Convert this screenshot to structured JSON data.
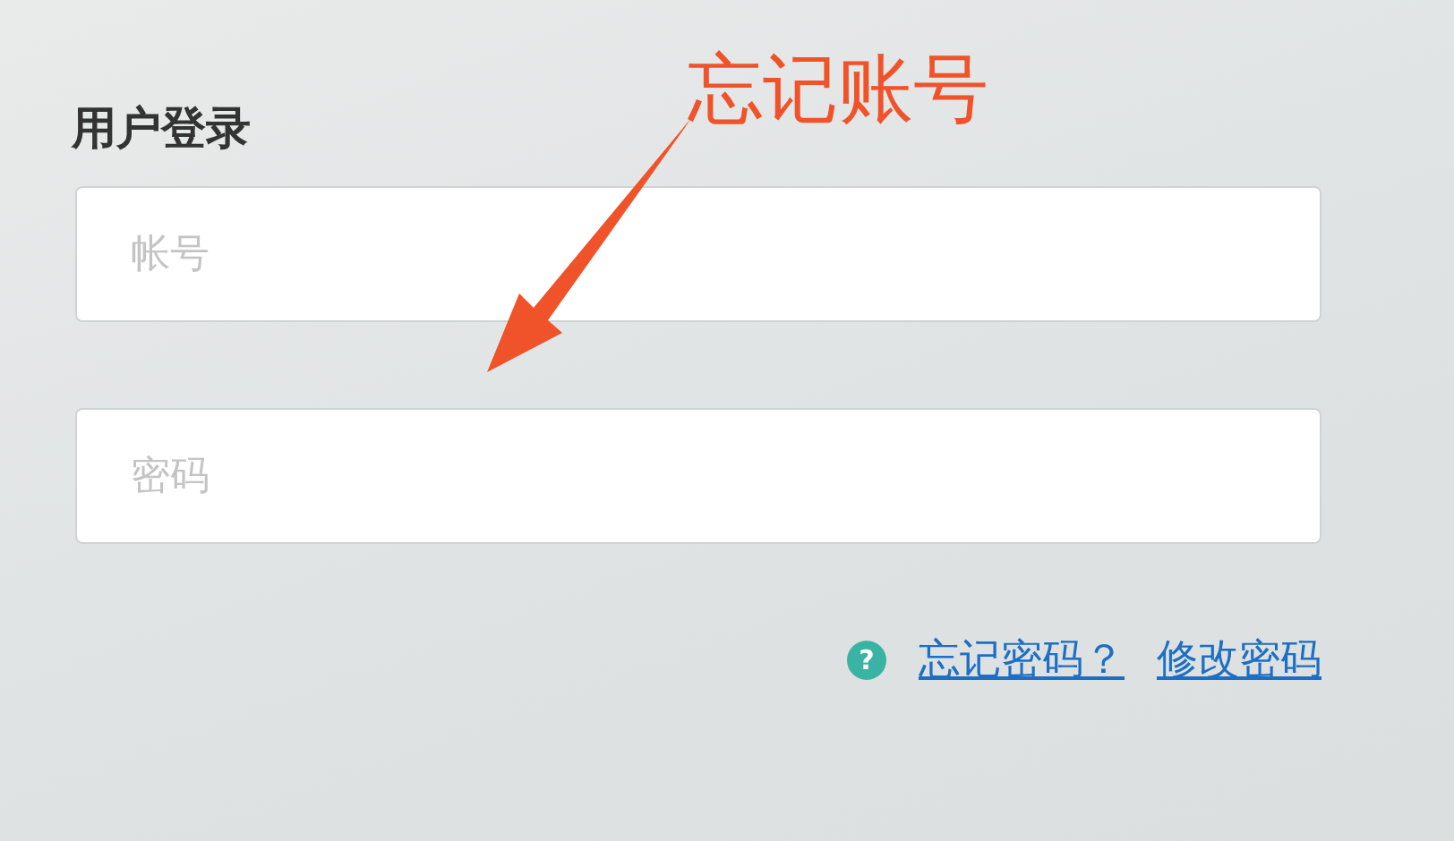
{
  "title": "用户登录",
  "fields": [
    {
      "placeholder": "帐号"
    },
    {
      "placeholder": "密码"
    }
  ],
  "help_mark": "?",
  "links": [
    "忘记密码？",
    "修改密码"
  ],
  "annotation": {
    "text": "忘记账号"
  }
}
